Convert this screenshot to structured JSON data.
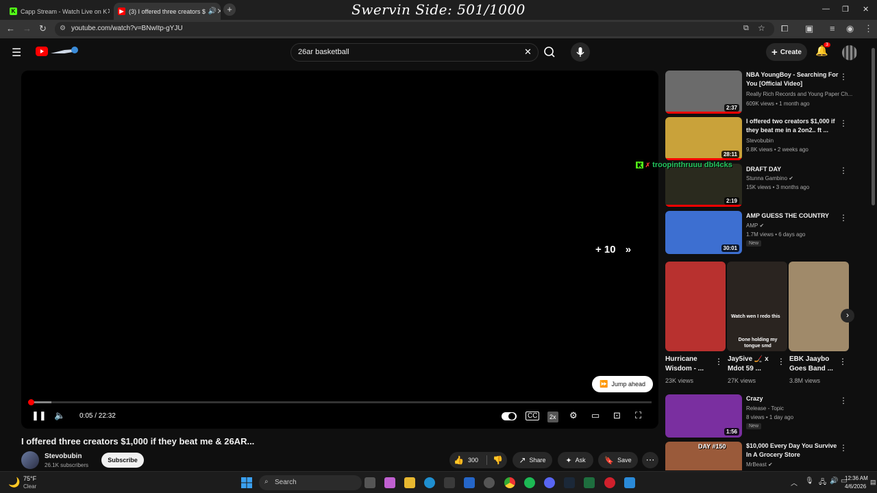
{
  "browser": {
    "tabs": [
      {
        "label": "Capp Stream - Watch Live on K"
      },
      {
        "label": "(3) I offered three creators $"
      }
    ],
    "url": "youtube.com/watch?v=BNwItp-gYJU"
  },
  "stream_overlay": "Swervin Side: 501/1000",
  "masthead": {
    "search_value": "26ar basketball",
    "create_label": "Create",
    "notification_count": "3"
  },
  "player": {
    "skip_label": "+ 10",
    "jump_ahead_label": "Jump ahead",
    "time_display": "0:05 / 22:32",
    "played_fraction": 0.004,
    "buffered_fraction": 0.037,
    "speed_label": "2x"
  },
  "video": {
    "title": "I offered three creators $1,000 if they beat me & 26AR...",
    "channel_name": "Stevobubin",
    "subscribers": "26.1K subscribers",
    "subscribe_label": "Subscribe",
    "like_count": "300",
    "share_label": "Share",
    "ask_label": "Ask",
    "save_label": "Save"
  },
  "chat_overlay": "troopinthruuu dbl4cks",
  "recommendations": [
    {
      "title": "NBA YoungBoy - Searching For You [Official Video]",
      "channel": "Really Rich Records and Young Paper Ch...",
      "meta": "609K views • 1 month ago",
      "duration": "2:37",
      "new": "",
      "thumb_color": "#6b6b6b",
      "progress": 1.0
    },
    {
      "title": "I offered two creators $1,000 if they beat me in a 2on2.. ft ...",
      "channel": "Stevobubin",
      "meta": "9.8K views • 2 weeks ago",
      "duration": "28:11",
      "new": "",
      "thumb_color": "#c9a23a",
      "progress": 1.0
    },
    {
      "title": "DRAFT DAY",
      "channel": "Stunna Gambino",
      "meta": "15K views • 3 months ago",
      "duration": "2:19",
      "new": "",
      "thumb_color": "#2a2a1e",
      "progress": 1.0
    },
    {
      "title": "AMP GUESS THE COUNTRY",
      "channel": "AMP",
      "meta": "1.7M views • 6 days ago",
      "duration": "30:01",
      "new": "New",
      "thumb_color": "#3d6fd1",
      "progress": 0
    },
    {
      "title": "Crazy",
      "channel": "Release - Topic",
      "meta": "8 views • 1 day ago",
      "duration": "1:56",
      "new": "New",
      "thumb_color": "#7a2fa0",
      "progress": 0
    },
    {
      "title": "$10,000 Every Day You Survive In A Grocery Store",
      "channel": "MrBeast",
      "meta": "",
      "duration": "",
      "new": "",
      "thumb_color": "#9a5a3a",
      "progress": 0
    }
  ],
  "shorts": [
    {
      "title": "Hurricane Wisdom - ...",
      "views": "23K views",
      "thumb_color": "#b8312f",
      "overlay": ""
    },
    {
      "title": "Jay5ive 🏒 x Mdot 59 ...",
      "views": "27K views",
      "thumb_color": "#2a2420",
      "overlay": "Watch wen I redo this"
    },
    {
      "title": "EBK Jaaybo Goes Band ...",
      "views": "3.8M views",
      "thumb_color": "#a08a6a",
      "overlay": ""
    }
  ],
  "shorts_extra_text": "Done holding my tongue smd",
  "taskbar": {
    "weather_temp": "75°F",
    "weather_desc": "Clear",
    "search_label": "Search",
    "time": "12:36 AM",
    "date": "4/6/2026"
  },
  "colors": {
    "accent": "#ff0000",
    "chat_green": "#22c55e"
  }
}
